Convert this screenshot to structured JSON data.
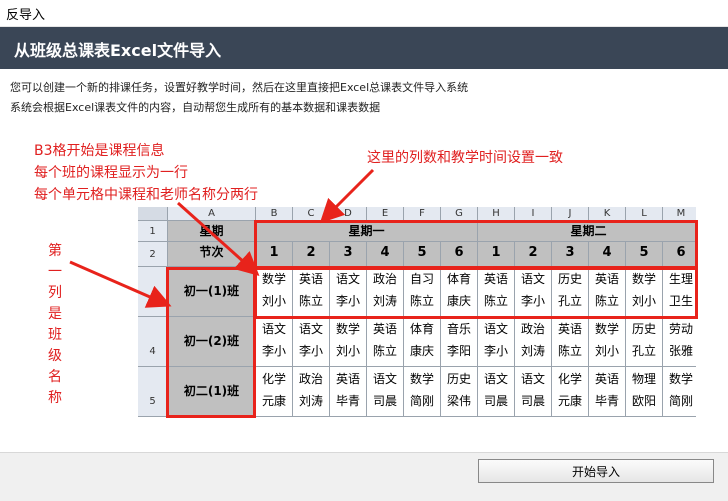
{
  "window": {
    "title": "反导入"
  },
  "banner": {
    "title": "从班级总课表Excel文件导入"
  },
  "description": {
    "line1": "您可以创建一个新的排课任务，设置好教学时间，然后在这里直接把Excel总课表文件导入系统",
    "line2": "系统会根据Excel课表文件的内容，自动帮您生成所有的基本数据和课表数据"
  },
  "annotations": {
    "top_left": [
      "B3格开始是课程信息",
      "每个班的课程显示为一行",
      "每个单元格中课程和老师名称分两行"
    ],
    "top_right": "这里的列数和教学时间设置一致",
    "left_vertical": [
      "第",
      "一",
      "列",
      "是",
      "班",
      "级",
      "名",
      "称"
    ]
  },
  "sheet": {
    "columns": [
      "A",
      "B",
      "C",
      "D",
      "E",
      "F",
      "G",
      "H",
      "I",
      "J",
      "K",
      "L",
      "M"
    ],
    "rows": [
      "1",
      "2",
      "3",
      "4",
      "5"
    ],
    "header_row1": {
      "a": "星期",
      "day1": "星期一",
      "day2": "星期二"
    },
    "header_row2": {
      "a": "节次",
      "periods": [
        "1",
        "2",
        "3",
        "4",
        "5",
        "6",
        "1",
        "2",
        "3",
        "4",
        "5",
        "6"
      ]
    },
    "classes": [
      {
        "name": "初一(1)班",
        "cells": [
          [
            "数学",
            "刘小"
          ],
          [
            "英语",
            "陈立"
          ],
          [
            "语文",
            "李小"
          ],
          [
            "政治",
            "刘涛"
          ],
          [
            "自习",
            "陈立"
          ],
          [
            "体育",
            "康庆"
          ],
          [
            "英语",
            "陈立"
          ],
          [
            "语文",
            "李小"
          ],
          [
            "历史",
            "孔立"
          ],
          [
            "英语",
            "陈立"
          ],
          [
            "数学",
            "刘小"
          ],
          [
            "生理",
            "卫生"
          ]
        ]
      },
      {
        "name": "初一(2)班",
        "cells": [
          [
            "语文",
            "李小"
          ],
          [
            "语文",
            "李小"
          ],
          [
            "数学",
            "刘小"
          ],
          [
            "英语",
            "陈立"
          ],
          [
            "体育",
            "康庆"
          ],
          [
            "音乐",
            "李阳"
          ],
          [
            "语文",
            "李小"
          ],
          [
            "政治",
            "刘涛"
          ],
          [
            "英语",
            "陈立"
          ],
          [
            "数学",
            "刘小"
          ],
          [
            "历史",
            "孔立"
          ],
          [
            "劳动",
            "张雅"
          ]
        ]
      },
      {
        "name": "初二(1)班",
        "cells": [
          [
            "化学",
            "元康"
          ],
          [
            "政治",
            "刘涛"
          ],
          [
            "英语",
            "毕青"
          ],
          [
            "语文",
            "司晨"
          ],
          [
            "数学",
            "简刚"
          ],
          [
            "历史",
            "梁伟"
          ],
          [
            "语文",
            "司晨"
          ],
          [
            "语文",
            "司晨"
          ],
          [
            "化学",
            "元康"
          ],
          [
            "英语",
            "毕青"
          ],
          [
            "物理",
            "欧阳"
          ],
          [
            "数学",
            "简刚"
          ]
        ]
      }
    ]
  },
  "footer": {
    "start_import_label": "开始导入"
  },
  "colors": {
    "annotation_red": "#e02020",
    "banner_bg": "#3a4656"
  }
}
